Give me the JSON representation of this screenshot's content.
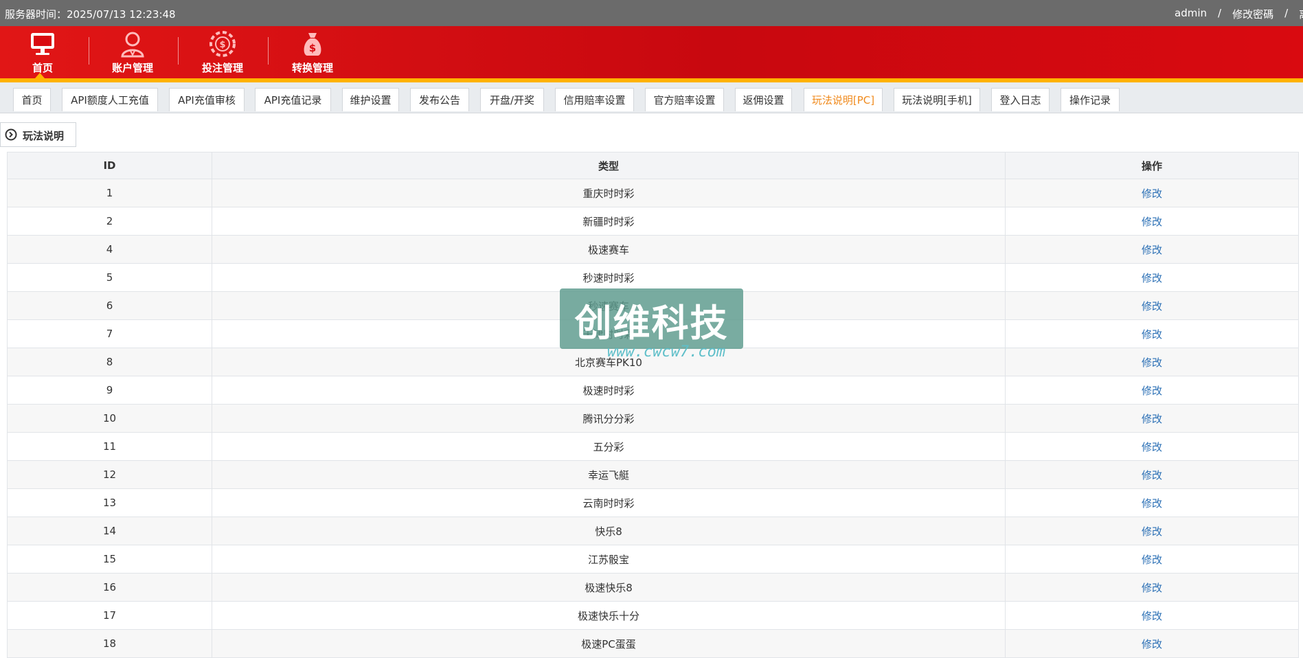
{
  "topbar": {
    "server_time": "服务器时间：2025/07/13 12:23:48",
    "user": "admin",
    "separator": "/",
    "change_password": "修改密碼",
    "logout": "离开"
  },
  "nav": {
    "items": [
      {
        "label": "首页",
        "icon": "monitor-icon"
      },
      {
        "label": "账户管理",
        "icon": "user-icon"
      },
      {
        "label": "投注管理",
        "icon": "casino-chip-icon"
      },
      {
        "label": "转换管理",
        "icon": "money-bag-icon"
      }
    ]
  },
  "tabs": [
    {
      "label": "首页"
    },
    {
      "label": "API额度人工充值"
    },
    {
      "label": "API充值审核"
    },
    {
      "label": "API充值记录"
    },
    {
      "label": "维护设置"
    },
    {
      "label": "发布公告"
    },
    {
      "label": "开盘/开奖"
    },
    {
      "label": "信用赔率设置"
    },
    {
      "label": "官方赔率设置"
    },
    {
      "label": "返佣设置"
    },
    {
      "label": "玩法说明[PC]",
      "active": true
    },
    {
      "label": "玩法说明[手机]"
    },
    {
      "label": "登入日志"
    },
    {
      "label": "操作记录"
    }
  ],
  "section": {
    "title": "玩法说明",
    "icon": "circle-arrow-right-icon"
  },
  "table": {
    "headers": {
      "id": "ID",
      "type": "类型",
      "action": "操作"
    },
    "rows": [
      {
        "id": "1",
        "type": "重庆时时彩",
        "action": "修改"
      },
      {
        "id": "2",
        "type": "新疆时时彩",
        "action": "修改"
      },
      {
        "id": "4",
        "type": "极速赛车",
        "action": "修改"
      },
      {
        "id": "5",
        "type": "秒速时时彩",
        "action": "修改"
      },
      {
        "id": "6",
        "type": "秒速赛车",
        "action": "修改"
      },
      {
        "id": "7",
        "type": "天津时时彩",
        "action": "修改"
      },
      {
        "id": "8",
        "type": "北京赛车PK10",
        "action": "修改"
      },
      {
        "id": "9",
        "type": "极速时时彩",
        "action": "修改"
      },
      {
        "id": "10",
        "type": "腾讯分分彩",
        "action": "修改"
      },
      {
        "id": "11",
        "type": "五分彩",
        "action": "修改"
      },
      {
        "id": "12",
        "type": "幸运飞艇",
        "action": "修改"
      },
      {
        "id": "13",
        "type": "云南时时彩",
        "action": "修改"
      },
      {
        "id": "14",
        "type": "快乐8",
        "action": "修改"
      },
      {
        "id": "15",
        "type": "江苏骰宝",
        "action": "修改"
      },
      {
        "id": "16",
        "type": "极速快乐8",
        "action": "修改"
      },
      {
        "id": "17",
        "type": "极速快乐十分",
        "action": "修改"
      },
      {
        "id": "18",
        "type": "极速PC蛋蛋",
        "action": "修改"
      }
    ]
  },
  "watermark": {
    "text": "创维科技",
    "url": "www.cwcw7.com"
  },
  "colors": {
    "topbar": "#6b6b6b",
    "header_red": "#d90a10",
    "accent_orange": "#f08a1c",
    "link_blue": "#2a6fb5"
  }
}
